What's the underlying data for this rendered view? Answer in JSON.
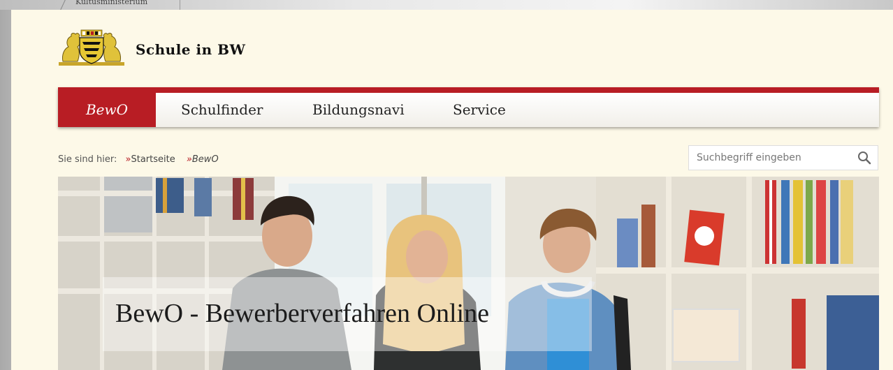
{
  "browser": {
    "tab_title": "Kultusministerium"
  },
  "header": {
    "site_title": "Schule in BW",
    "logo_icon": "coat-of-arms-icon"
  },
  "nav": {
    "items": [
      {
        "label": "BewO",
        "active": true
      },
      {
        "label": "Schulfinder",
        "active": false
      },
      {
        "label": "Bildungsnavi",
        "active": false
      },
      {
        "label": "Service",
        "active": false
      }
    ],
    "accent_color": "#b81d24"
  },
  "breadcrumb": {
    "prefix": "Sie sind hier:",
    "items": [
      "Startseite",
      "BewO"
    ],
    "separator": "»"
  },
  "search": {
    "placeholder": "Suchbegriff eingeben",
    "value": "",
    "icon": "search-icon"
  },
  "hero": {
    "title": "BewO - Bewerberverfahren Online",
    "image_icon": "students-in-library-photo"
  },
  "colors": {
    "page_background": "#fdf9e8",
    "brand_red": "#b81d24"
  }
}
